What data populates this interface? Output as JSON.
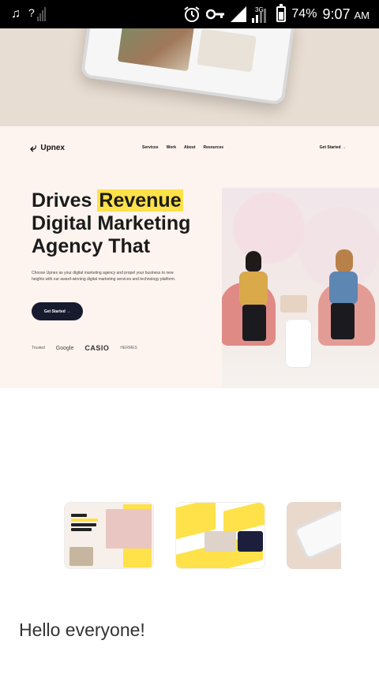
{
  "status_bar": {
    "left_icons": [
      "music-note-icon",
      "no-signal-icon"
    ],
    "right_icons": [
      "alarm-icon",
      "vpn-key-icon",
      "signal-icon",
      "network-3g-icon",
      "battery-icon"
    ],
    "network_type": "3G",
    "battery_percent": "74%",
    "time": "9:07",
    "time_suffix": "AM"
  },
  "site_preview": {
    "logo_text": "Upnex",
    "nav_links": [
      "Services",
      "Work",
      "About",
      "Resources"
    ],
    "nav_cta": "Get Started →",
    "headline": {
      "line1_pre": "Drives ",
      "line1_highlight": "Revenue",
      "line2": "Digital Marketing",
      "line3": "Agency That"
    },
    "description": "Choose Upnex as your digital marketing agency and propel your business to new heights with our award-winning digital marketing services and technology platform.",
    "cta_button": "Get Started →",
    "trusted": {
      "label": "Trusted",
      "brands": [
        "Google",
        "CASIO",
        "HERMES"
      ]
    },
    "accent_color": "#ffe14a",
    "dark_color": "#161b2e"
  },
  "thumbnails": {
    "count_visible": 3,
    "selected_index": 0
  },
  "message": {
    "text": "Hello everyone!"
  }
}
